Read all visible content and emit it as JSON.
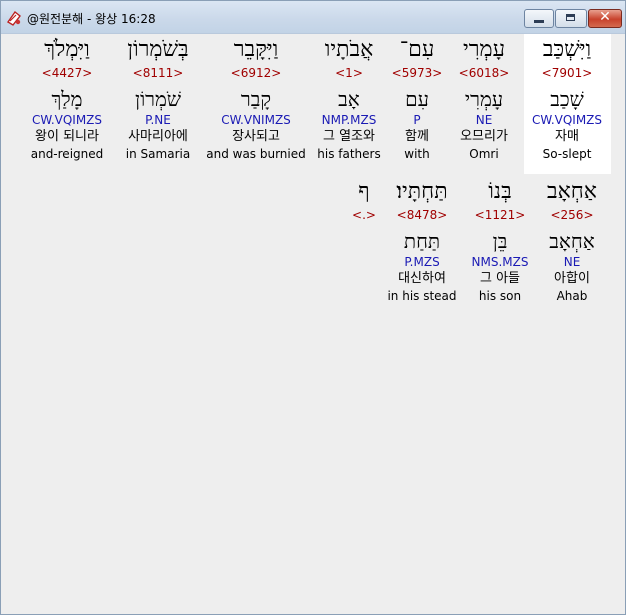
{
  "window": {
    "title": "@원전분해 - 왕상 16:28"
  },
  "words": [
    {
      "heb": "וַיִּשְׁכַּב",
      "strong": "<7901>",
      "lemma": "שָׁכַב",
      "morph": "CW.VQIMZS",
      "kor": "자매",
      "eng": "So-slept",
      "highlighted": true
    },
    {
      "heb": "עָמְרִי",
      "strong": "<6018>",
      "lemma": "עָמְרִי",
      "morph": "NE",
      "kor": "오므리가",
      "eng": "Omri"
    },
    {
      "heb": "עִם־",
      "strong": "<5973>",
      "lemma": "עִם",
      "morph": "P",
      "kor": "함께",
      "eng": "with"
    },
    {
      "heb": "אֲבֹתָיו",
      "strong": "<1>",
      "lemma": "אָב",
      "morph": "NMP.MZS",
      "kor": "그 열조와",
      "eng": "his fathers"
    },
    {
      "heb": "וַיִּקָּבֵר",
      "strong": "<6912>",
      "lemma": "קָבַר",
      "morph": "CW.VNIMZS",
      "kor": "장사되고",
      "eng": "and was burnied"
    },
    {
      "heb": "בְּשֹׁמְרוֹן",
      "strong": "<8111>",
      "lemma": "שֹׁמְרוֹן",
      "morph": "P.NE",
      "kor": "사마리아에",
      "eng": "in Samaria"
    },
    {
      "heb": "וַיִּמְלֹךְ",
      "strong": "<4427>",
      "lemma": "מָלַךְ",
      "morph": "CW.VQIMZS",
      "kor": "왕이 되니라",
      "eng": "and-reigned"
    },
    {
      "heb": "אַחְאָב",
      "strong": "<256>",
      "lemma": "אַחְאָב",
      "morph": "NE",
      "kor": "아합이",
      "eng": "Ahab"
    },
    {
      "heb": "בְּנוֹ",
      "strong": "<1121>",
      "lemma": "בֵּן",
      "morph": "NMS.MZS",
      "kor": "그 아들",
      "eng": "his son"
    },
    {
      "heb": "תַּחְתָּיו׃",
      "strong": "<8478>",
      "lemma": "תַּחַת",
      "morph": "P.MZS",
      "kor": "대신하여",
      "eng": "in his stead"
    },
    {
      "heb": "ף",
      "strong": "<.>",
      "lemma": "",
      "morph": "",
      "kor": "",
      "eng": ""
    }
  ]
}
